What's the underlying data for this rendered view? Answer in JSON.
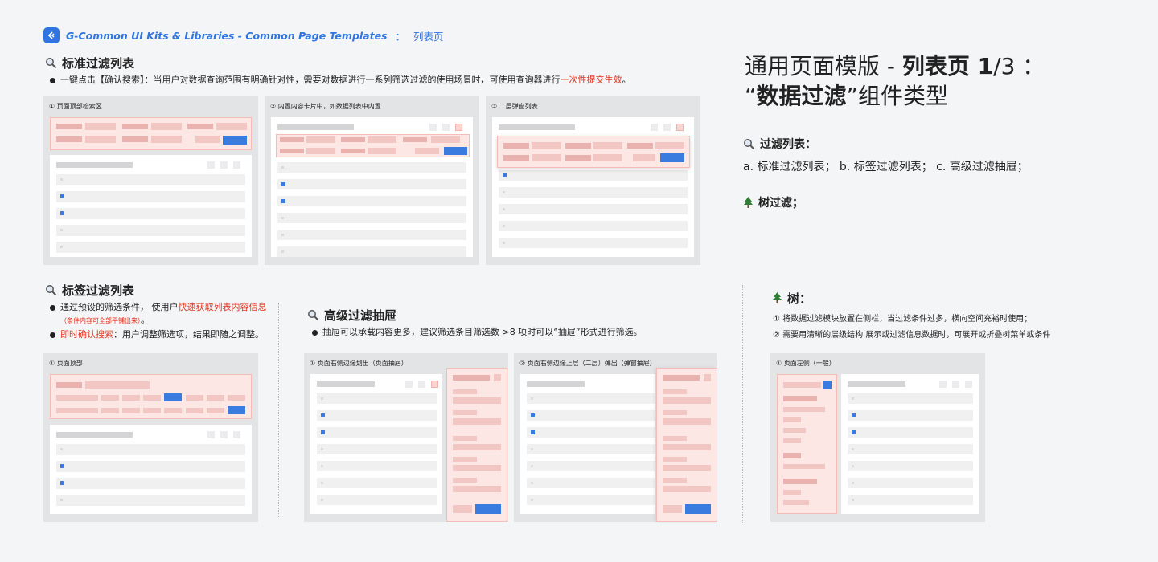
{
  "header": {
    "title": "G-Common UI Kits & Libraries - Common Page Templates",
    "colon": "：",
    "subtitle": "列表页"
  },
  "std_filter": {
    "title": "标准过滤列表",
    "desc_pre": "一键点击【确认搜索】：当用户对数据查询范围有明确针对性，需要对数据进行一系列筛选过滤的使用场景时，可使用查询器进行",
    "desc_red": "一次性提交生效",
    "desc_post": "。",
    "panels": [
      {
        "label": "① 页面顶部检索区"
      },
      {
        "label": "② 内置内容卡片中，如数据列表中内置"
      },
      {
        "label": "③ 二层弹窗列表"
      }
    ]
  },
  "tag_filter": {
    "title": "标签过滤列表",
    "b1_pre": "通过预设的筛选条件， 使用户",
    "b1_red": "快速获取列表内容信息",
    "b1_note": "（条件内容可全部平铺出来）",
    "b1_end": "。",
    "b2_red": "即时确认搜索",
    "b2_post": "：用户调整筛选项，结果即随之调整。",
    "panel_label": "① 页面顶部"
  },
  "drawer": {
    "title": "高级过滤抽屉",
    "desc": "抽屉可以承载内容更多，建议筛选条目筛选数 >8 项时可以“抽屉”形式进行筛选。",
    "panels": [
      {
        "label": "① 页面右侧边缘划出（页面抽屉）"
      },
      {
        "label": "②   页面右侧边缘上层（二层）弹出（弹窗抽屉）"
      }
    ]
  },
  "tree": {
    "title": "树：",
    "note1": "① 将数据过滤模块放置在侧栏，当过滤条件过多，横向空间充裕时使用；",
    "note2": "② 需要用清晰的层级结构 展示或过滤信息数据时，可展开或折叠树菜单或条件",
    "panel_label": "①   页面左侧（一般）"
  },
  "right": {
    "title_pre": "通用页面模版 - ",
    "title_bold": "列表页 1",
    "title_post": "/3 ：",
    "title2_q1": "“",
    "title2_bold": "数据过滤",
    "title2_post": "”组件类型",
    "filter_list_label": "过滤列表：",
    "filter_types": "a. 标准过滤列表；   b. 标签过滤列表；   c. 高级过滤抽屉；",
    "tree_filter_label": "树过滤；"
  },
  "colors": {
    "accent": "#2f74e0",
    "red": "#e2341d",
    "pink_bg": "#fde7e5",
    "panel_bg": "#e3e4e6"
  },
  "icons": [
    "magnifier-icon",
    "tree-icon",
    "logo-icon"
  ]
}
